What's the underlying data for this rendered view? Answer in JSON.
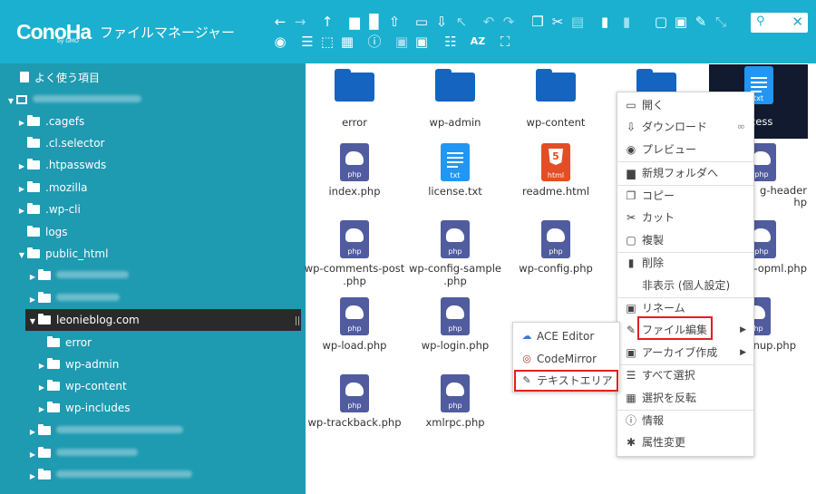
{
  "header": {
    "logo": "ConoHa",
    "logo_sub": "by GMO",
    "title": "ファイルマネージャー",
    "toolbar_row1": [
      "back-icon",
      "forward-icon",
      "up-icon",
      "new-folder-icon",
      "new-file-icon",
      "upload-icon",
      "open-folder-icon",
      "download-icon",
      "cursor-icon",
      "undo-icon",
      "redo-icon",
      "copy-icon",
      "cut-icon",
      "paste-icon",
      "delete-icon",
      "empty-icon",
      "duplicate-icon",
      "rename-icon",
      "edit-icon",
      "resize-icon"
    ],
    "toolbar_row2": [
      "preview-icon",
      "select-all-icon",
      "select-none-icon",
      "invert-select-icon",
      "info-icon",
      "archive-icon",
      "extract-icon",
      "view-icon",
      "sort-icon",
      "fullscreen-icon"
    ]
  },
  "search": {
    "icon": "search-icon",
    "clear": "close-icon"
  },
  "sidebar": {
    "favorites": "よく使う項目",
    "items": [
      {
        "label": ".cagefs"
      },
      {
        "label": ".cl.selector"
      },
      {
        "label": ".htpasswds"
      },
      {
        "label": ".mozilla"
      },
      {
        "label": ".wp-cli"
      },
      {
        "label": "logs"
      },
      {
        "label": "public_html"
      },
      {
        "label": "leonieblog.com"
      },
      {
        "label": "error"
      },
      {
        "label": "wp-admin"
      },
      {
        "label": "wp-content"
      },
      {
        "label": "wp-includes"
      }
    ]
  },
  "files": [
    {
      "label": "error",
      "type": "folder"
    },
    {
      "label": "wp-admin",
      "type": "folder"
    },
    {
      "label": "wp-content",
      "type": "folder"
    },
    {
      "label": "index.php",
      "type": "php"
    },
    {
      "label": "license.txt",
      "type": "txt"
    },
    {
      "label": "readme.html",
      "type": "html"
    },
    {
      "label": "wp-comments-post\n.php",
      "type": "php"
    },
    {
      "label": "wp-config-sample\n.php",
      "type": "php"
    },
    {
      "label": "wp-config.php",
      "type": "php"
    },
    {
      "label": "wp-load.php",
      "type": "php"
    },
    {
      "label": "wp-login.php",
      "type": "php"
    },
    {
      "label": "wp-trackback.php",
      "type": "php"
    },
    {
      "label": "xmlrpc.php",
      "type": "php"
    }
  ],
  "file_labels": {
    "access": "ccess",
    "header_partial": "g-header",
    "header_partial2": "hp",
    "opml_partial": "-opml.php",
    "signup_partial": "nup.php"
  },
  "file_icon_text": {
    "php": "php",
    "txt": "txt",
    "html": "html",
    "html5": "5"
  },
  "context_menu": [
    {
      "label": "開く",
      "icon": "open-icon"
    },
    {
      "label": "ダウンロード",
      "icon": "download-icon"
    },
    {
      "label": "プレビュー",
      "icon": "eye-icon"
    },
    {
      "label": "新規フォルダへ",
      "icon": "folder-plus-icon"
    },
    {
      "label": "コピー",
      "icon": "copy-icon"
    },
    {
      "label": "カット",
      "icon": "scissors-icon"
    },
    {
      "label": "複製",
      "icon": "duplicate-icon"
    },
    {
      "label": "削除",
      "icon": "trash-icon"
    },
    {
      "label": "非表示 (個人設定)",
      "icon": ""
    },
    {
      "label": "リネーム",
      "icon": "rename-icon"
    },
    {
      "label": "ファイル編集",
      "icon": "pencil-icon"
    },
    {
      "label": "アーカイブ作成",
      "icon": "archive-icon"
    },
    {
      "label": "すべて選択",
      "icon": "select-all-icon"
    },
    {
      "label": "選択を反転",
      "icon": "invert-icon"
    },
    {
      "label": "情報",
      "icon": "info-icon"
    },
    {
      "label": "属性変更",
      "icon": "asterisk-icon"
    }
  ],
  "sub_menu": [
    {
      "label": "ACE Editor",
      "icon": "cloud-icon"
    },
    {
      "label": "CodeMirror",
      "icon": "codemirror-icon"
    },
    {
      "label": "テキストエリア",
      "icon": "pencil-icon"
    }
  ],
  "colors": {
    "header": "#1bb0cf",
    "sidebar": "#1e9ab1",
    "highlight": "#e02020",
    "folder": "#1565c0"
  }
}
